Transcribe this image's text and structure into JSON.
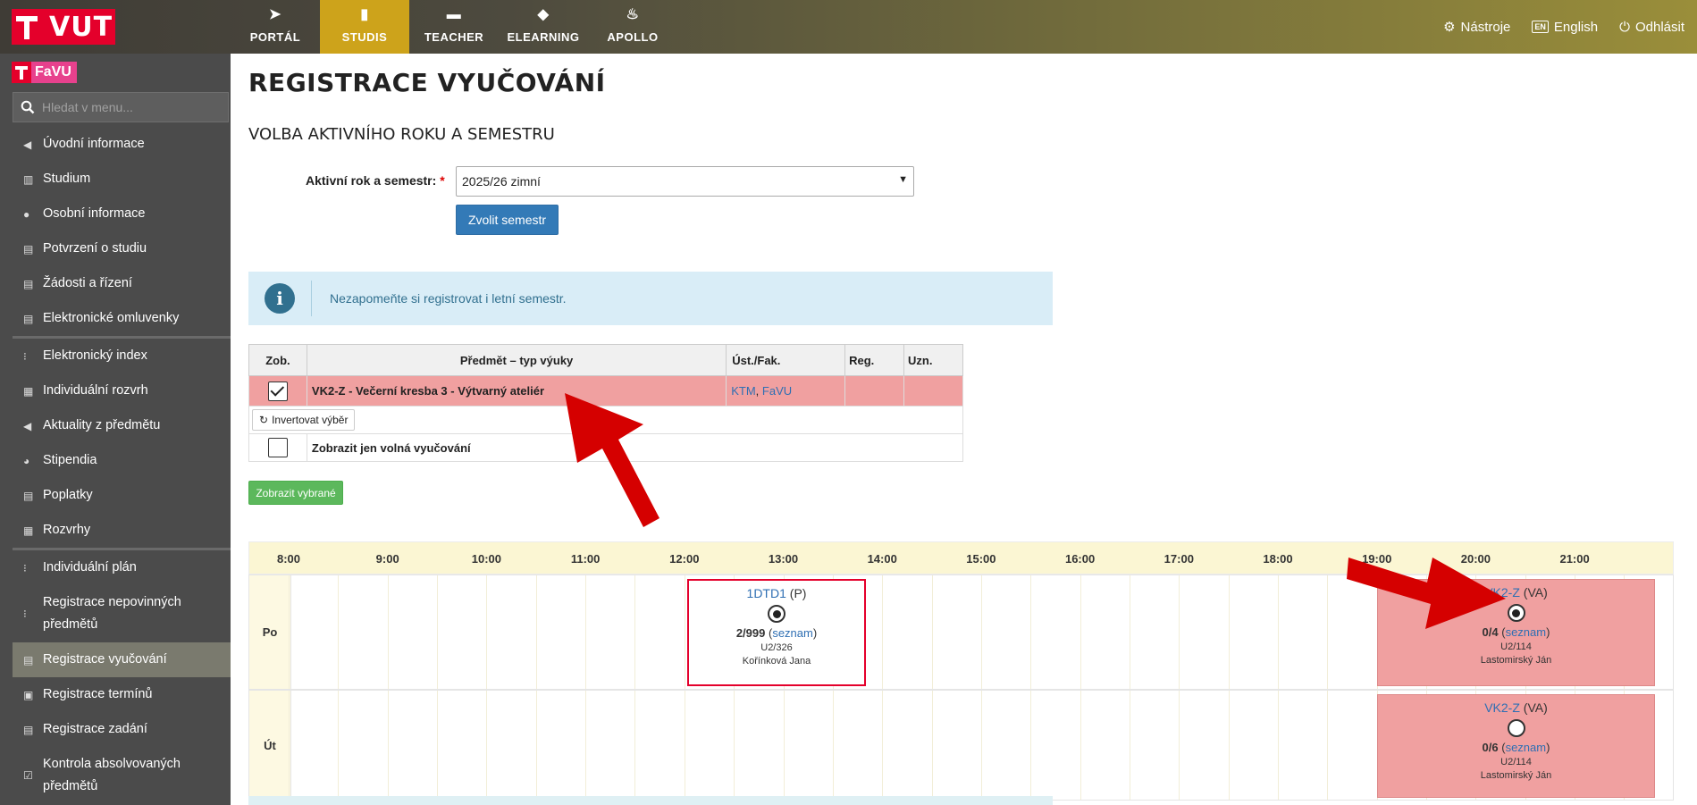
{
  "header": {
    "logo_text": "VUT",
    "nav": [
      {
        "label": "PORTÁL",
        "icon": "paper-plane-icon",
        "active": false
      },
      {
        "label": "STUDIS",
        "icon": "book-icon",
        "active": true
      },
      {
        "label": "TEACHER",
        "icon": "briefcase-icon",
        "active": false
      },
      {
        "label": "ELEARNING",
        "icon": "graduation-cap-icon",
        "active": false
      },
      {
        "label": "APOLLO",
        "icon": "flame-icon",
        "active": false
      }
    ],
    "tools_label": "Nástroje",
    "lang_badge": "EN",
    "lang_label": "English",
    "logout_label": "Odhlásit"
  },
  "sidebar": {
    "faculty": "FaVU",
    "search_placeholder": "Hledat v menu...",
    "items": [
      "Úvodní informace",
      "Studium",
      "Osobní informace",
      "Potvrzení o studiu",
      "Žádosti a řízení",
      "Elektronické omluvenky",
      "Elektronický index",
      "Individuální rozvrh",
      "Aktuality z předmětu",
      "Stipendia",
      "Poplatky",
      "Rozvrhy",
      "Individuální plán",
      "Registrace nepovinných předmětů",
      "Registrace vyučování",
      "Registrace termínů",
      "Registrace zadání",
      "Kontrola absolvovaných předmětů"
    ]
  },
  "main": {
    "title": "REGISTRACE VYUČOVÁNÍ",
    "section_title": "VOLBA AKTIVNÍHO ROKU A SEMESTRU",
    "semester_label": "Aktivní rok a semestr:",
    "required_mark": "*",
    "semester_value": "2025/26 zimní",
    "choose_button": "Zvolit semestr",
    "info_text": "Nezapomeňte si registrovat i letní semestr.",
    "table": {
      "headers": [
        "Zob.",
        "Předmět – typ výuky",
        "Úst./Fak.",
        "Reg.",
        "Uzn."
      ],
      "row": {
        "subject": "VK2-Z - Večerní kresba 3 - Výtvarný ateliér",
        "inst": "KTM",
        "sep": ", ",
        "fac": "FaVU"
      },
      "invert_label": "Invertovat výběr",
      "free_only_label": "Zobrazit jen volná vyučování"
    },
    "show_button": "Zobrazit vybrané"
  },
  "schedule": {
    "hours": [
      "8:00",
      "9:00",
      "10:00",
      "11:00",
      "12:00",
      "13:00",
      "14:00",
      "15:00",
      "16:00",
      "17:00",
      "18:00",
      "19:00",
      "20:00",
      "21:00"
    ],
    "days": [
      "Po",
      "Út"
    ],
    "events": {
      "dtd": {
        "code": "1DTD1",
        "type": "(P)",
        "count": "2/999",
        "list": "seznam",
        "room": "U2/326",
        "teacher": "Kořínková Jana"
      },
      "vk_po": {
        "code": "VK2-Z",
        "type": "(VA)",
        "count": "0/4",
        "list": "seznam",
        "room": "U2/114",
        "teacher": "Lastomirský Ján"
      },
      "vk_ut": {
        "code": "VK2-Z",
        "type": "(VA)",
        "count": "0/6",
        "list": "seznam",
        "room": "U2/114",
        "teacher": "Lastomirský Ján"
      }
    }
  },
  "colors": {
    "brand_red": "#e4002b",
    "active_nav": "#cda31b",
    "accent_blue": "#337ab7",
    "selected_row": "#f0a0a0",
    "annotation_arrow": "#d50000"
  }
}
